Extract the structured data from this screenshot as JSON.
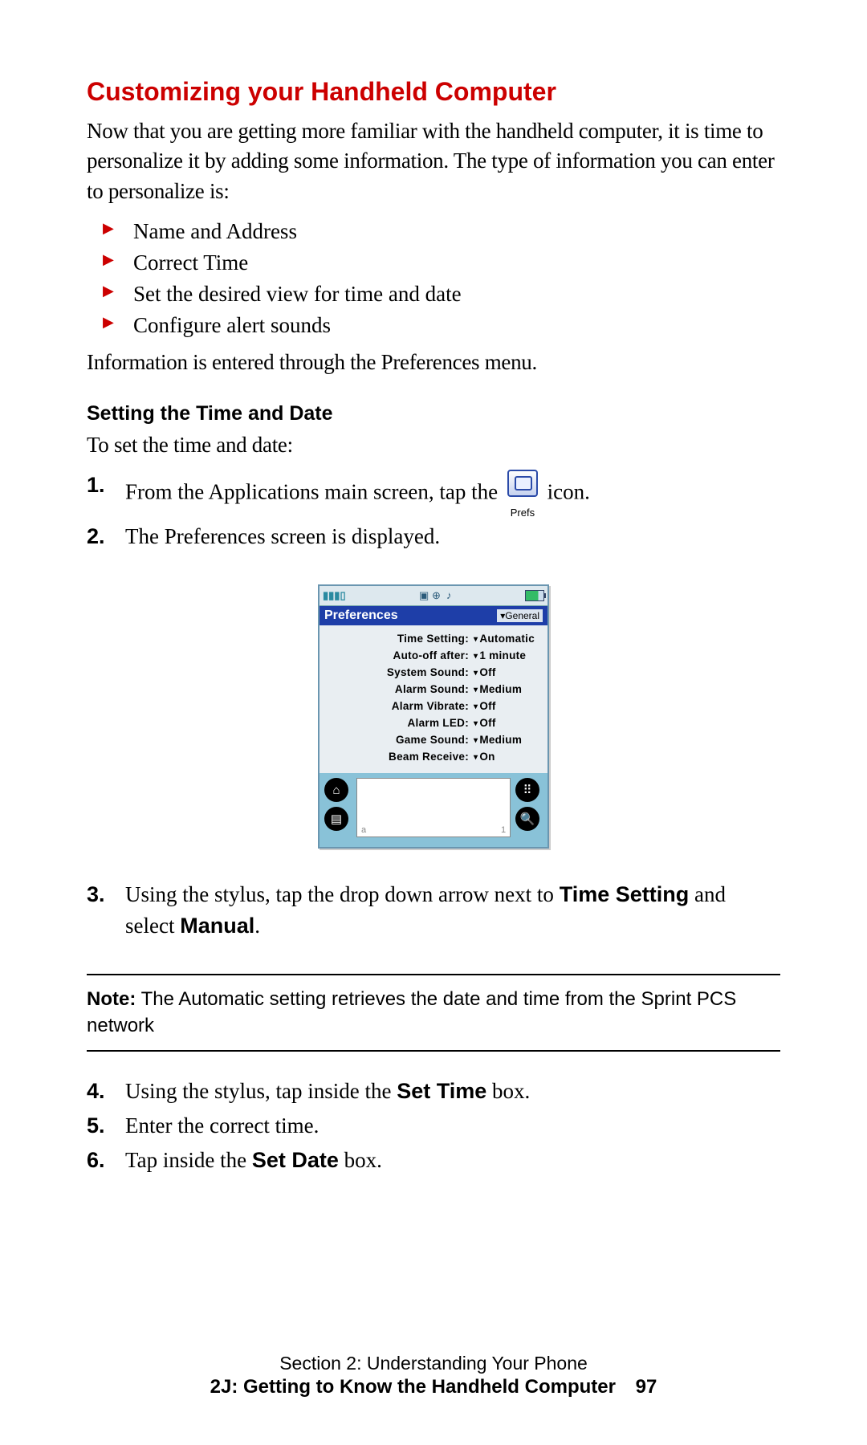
{
  "heading": "Customizing your Handheld Computer",
  "intro": "Now that you are getting more familiar with the handheld computer, it is time to personalize it by adding some information. The type of information you can enter to personalize is:",
  "bullets": [
    "Name and Address",
    "Correct Time",
    "Set the desired view for time and date",
    "Configure alert sounds"
  ],
  "after_bullets": "Information is entered through the Preferences menu.",
  "subheading": "Setting the Time and Date",
  "sub_intro": "To set the time and date:",
  "steps": {
    "s1": {
      "num": "1.",
      "pre": "From the Applications main screen, tap the ",
      "post": " icon."
    },
    "s2": {
      "num": "2.",
      "text": "The Preferences screen is displayed."
    },
    "s3": {
      "num": "3.",
      "pre": "Using the stylus, tap the drop down arrow next to ",
      "bold1": "Time Setting",
      "mid": " and select ",
      "bold2": "Manual",
      "post": "."
    },
    "s4": {
      "num": "4.",
      "pre": "Using the stylus, tap inside the ",
      "bold1": "Set Time",
      "post": " box."
    },
    "s5": {
      "num": "5.",
      "text": "Enter the correct time."
    },
    "s6": {
      "num": "6.",
      "pre": "Tap inside the ",
      "bold1": "Set Date",
      "post": " box."
    }
  },
  "prefs_icon_label": "Prefs",
  "device": {
    "title": "Preferences",
    "category": "▾General",
    "rows": [
      {
        "label": "Time Setting:",
        "value": "Automatic"
      },
      {
        "label": "Auto-off after:",
        "value": "1 minute"
      },
      {
        "label": "System Sound:",
        "value": "Off"
      },
      {
        "label": "Alarm Sound:",
        "value": "Medium"
      },
      {
        "label": "Alarm Vibrate:",
        "value": "Off"
      },
      {
        "label": "Alarm LED:",
        "value": "Off"
      },
      {
        "label": "Game Sound:",
        "value": "Medium"
      },
      {
        "label": "Beam Receive:",
        "value": "On"
      }
    ],
    "graffiti_left": "a",
    "graffiti_right": "1"
  },
  "note": {
    "label": "Note:",
    "text": " The Automatic setting retrieves the date and time from the Sprint PCS network"
  },
  "footer": {
    "line1": "Section 2: Understanding Your Phone",
    "line2": "2J: Getting to Know the Handheld Computer",
    "page": "97"
  }
}
